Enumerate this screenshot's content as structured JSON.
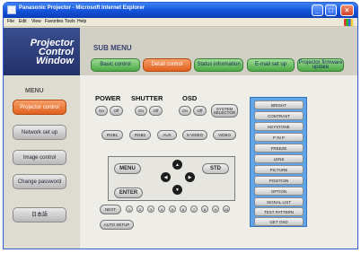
{
  "window": {
    "title": "Panasonic Projector - Microsoft Internet Explorer"
  },
  "menubar": [
    "File",
    "Edit",
    "View",
    "Favorites",
    "Tools",
    "Help"
  ],
  "app": {
    "logo_line1": "Projector",
    "logo_line2": "Control",
    "logo_line3": "Window",
    "menu_title": "MENU",
    "side_buttons": [
      "Projector control",
      "Network set up",
      "Image control",
      "Change password",
      "日本語"
    ]
  },
  "submenu": {
    "title": "SUB MENU",
    "buttons": [
      "Basic control",
      "Detail control",
      "Status information",
      "E-mail set up",
      "Projector firmware update"
    ]
  },
  "controls": {
    "power_label": "POWER",
    "shutter_label": "SHUTTER",
    "osd_label": "OSD",
    "on": "On",
    "off": "Off",
    "system_selector": "SYSTEM SELECTOR",
    "inputs": [
      "RGB1",
      "RGB2",
      "AUX",
      "S-VIDEO",
      "VIDEO"
    ],
    "menu": "MENU",
    "std": "STD",
    "enter": "ENTER",
    "next": "NEXT",
    "auto_setup": "AUTO SETUP",
    "numbers": [
      "1",
      "2",
      "3",
      "4",
      "5",
      "6",
      "7",
      "8",
      "9",
      "10"
    ]
  },
  "right_panel": [
    "BRIGHT",
    "CONTRAST",
    "KEYSTONE",
    "P IN P",
    "FREEZE",
    "LENS",
    "PICTURE",
    "POSITION",
    "OPTION",
    "SIGNAL LIST",
    "TEST PATTERN",
    "GET OSD"
  ]
}
